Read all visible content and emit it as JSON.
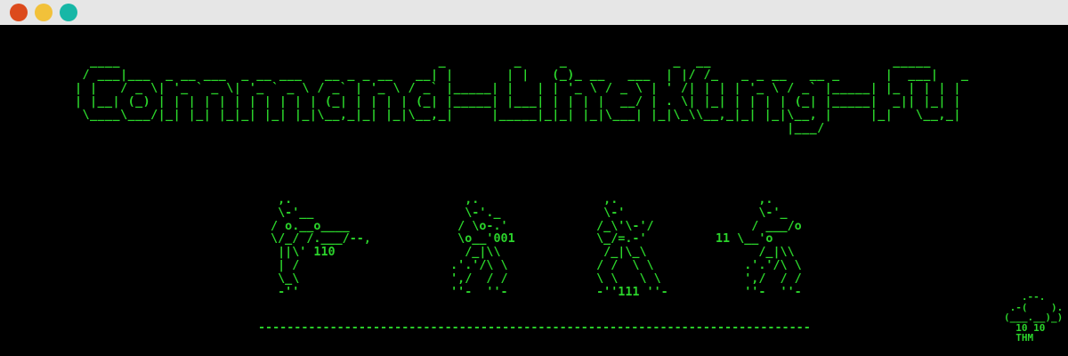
{
  "window": {
    "buttons": {
      "close": "#dc4a1c",
      "minimize": "#f2c13a",
      "maximize": "#17b7a6"
    }
  },
  "colors": {
    "text": "#2bd42b",
    "background": "#000000",
    "titlebar": "#e6e6e6"
  },
  "banner": {
    "title": "Command-Line Kung-Fu",
    "art": "  ____                                          _         _     _              _  __                        _____\n / ___|___  _ __ ___  _ __ ___   __ _ _ __   __| |       | |   (_)_ __   ___  | |/ /_   _ _ __   __ _      |  ___|   _\n| |   / _ \\| '_ ` _ \\| '_ ` _ \\ / _` | '_ \\ / _` |_____| |   | | '_ \\ / _ \\ | ' /| | | | '_ \\ / _` |_____| |_ | | | |\n| |__| (_) | | | | | | | | | | | (_| | | | | (_| |_____| |___| | | | |  __/ | . \\| |_| | | | | (_| |_____|  _|| |_| |\n \\____\\___/|_| |_| |_|_| |_| |_|\\__,_|_| |_|\\__,_|     |_____|_|_| |_|\\___| |_|\\_\\\\__,_|_| |_|\\__, |     |_|   \\__,_|\n                                                                                              |___/"
  },
  "figures": {
    "fig1": "  ,.\n  \\-'__\n / o.__o____\n \\/_/ /.___/--,\n  ||\\' 110\n  | /\n  \\_\\\n  -''",
    "fig2": "    ,.\n    \\-'._\n   / \\o-.'\n   \\o__'001\n    /_|\\\\\n  .'.'/\\ \\\n  ',/  / /\n  ''-  ''-",
    "fig3": "   ,.\n   \\-'\n  /_\\'\\-'/\n  \\_/=.-'\n   /_|\\_\\\n  / /  \\ \\\n  \\ \\   \\ \\\n  -''111 ''-",
    "fig4": "      ,.\n      \\-'_\n     / ___/o\n11 \\__'o\n      /_|\\\\\n    .'.'/\\ \\\n    ',/  / /\n    ''-  ''-"
  },
  "ground": "--------------------------------------------------------------------------------------------------------",
  "logo": {
    "art": "   .--.\n .-(    ).\n(___.__)_)\n  10 10\n  THM",
    "label": "THM"
  }
}
